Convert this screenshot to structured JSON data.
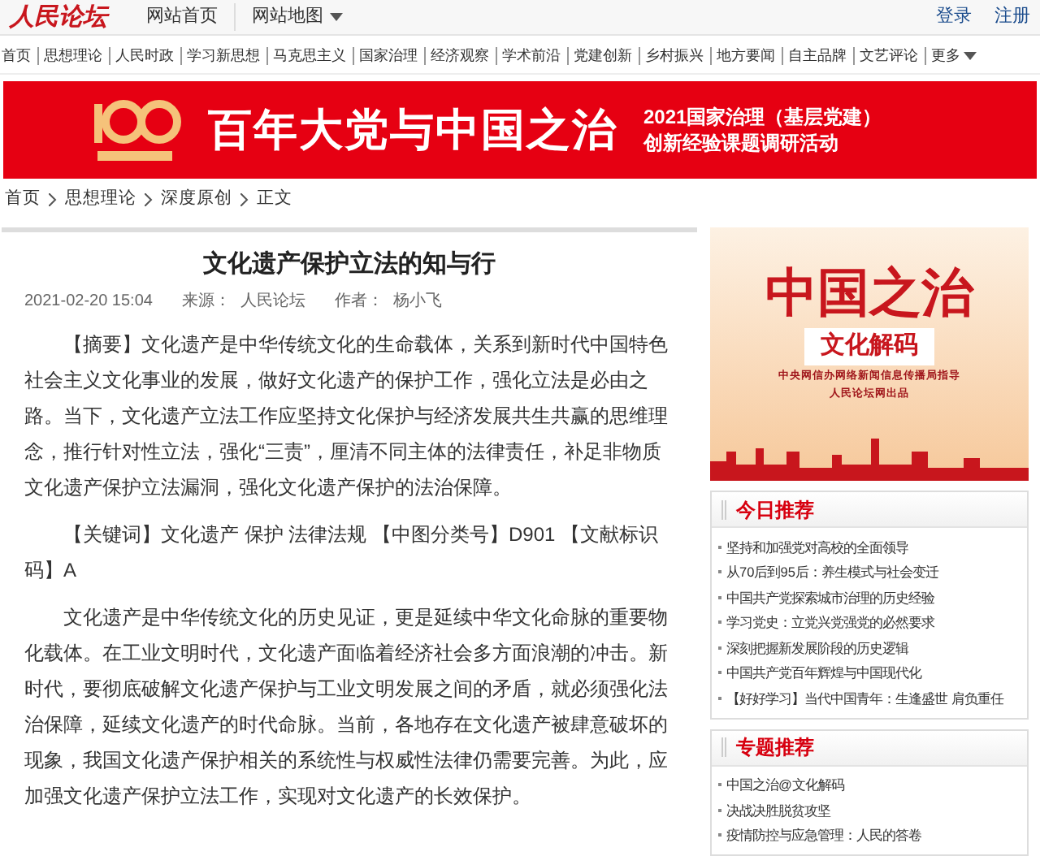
{
  "header": {
    "logo": "人民论坛",
    "links": [
      "网站首页",
      "网站地图"
    ],
    "login": "登录",
    "register": "注册"
  },
  "nav": [
    "首页",
    "思想理论",
    "人民时政",
    "学习新思想",
    "马克思主义",
    "国家治理",
    "经济观察",
    "学术前沿",
    "党建创新",
    "乡村振兴",
    "地方要闻",
    "自主品牌",
    "文艺评论"
  ],
  "nav_more": "更多",
  "banner": {
    "title": "百年大党与中国之治",
    "subtitle_lines": [
      "2021国家治理（基层党建）",
      "创新经验课题调研活动"
    ]
  },
  "breadcrumb": [
    "首页",
    "思想理论",
    "深度原创",
    "正文"
  ],
  "article": {
    "title": "文化遗产保护立法的知与行",
    "date": "2021-02-20 15:04",
    "source_label": "来源：",
    "source": "人民论坛",
    "author_label": "作者：",
    "author": "杨小飞",
    "paragraphs": [
      "【摘要】文化遗产是中华传统文化的生命载体，关系到新时代中国特色社会主义文化事业的发展，做好文化遗产的保护工作，强化立法是必由之路。当下，文化遗产立法工作应坚持文化保护与经济发展共生共赢的思维理念，推行针对性立法，强化“三责”，厘清不同主体的法律责任，补足非物质文化遗产保护立法漏洞，强化文化遗产保护的法治保障。",
      "【关键词】文化遗产 保护 法律法规 【中图分类号】D901 【文献标识码】A",
      "文化遗产是中华传统文化的历史见证，更是延续中华文化命脉的重要物化载体。在工业文明时代，文化遗产面临着经济社会多方面浪潮的冲击。新时代，要彻底破解文化遗产保护与工业文明发展之间的矛盾，就必须强化法治保障，延续文化遗产的时代命脉。当前，各地存在文化遗产被肆意破坏的现象，我国文化遗产保护相关的系统性与权威性法律仍需要完善。为此，应加强文化遗产保护立法工作，实现对文化遗产的长效保护。"
    ]
  },
  "promo": {
    "title": "中国之治",
    "tag": "文化解码",
    "lines": [
      "中央网信办网络新闻信息传播局指导",
      "人民论坛网出品"
    ]
  },
  "sidebar_boxes": [
    {
      "title": "今日推荐",
      "items": [
        "坚持和加强党对高校的全面领导",
        "从70后到95后：养生模式与社会变迁",
        "中国共产党探索城市治理的历史经验",
        "学习党史：立党兴党强党的必然要求",
        "深刻把握新发展阶段的历史逻辑",
        "中国共产党百年辉煌与中国现代化",
        "【好好学习】当代中国青年：生逢盛世 肩负重任"
      ]
    },
    {
      "title": "专题推荐",
      "items": [
        "中国之治@文化解码",
        "决战决胜脱贫攻坚",
        "疫情防控与应急管理：人民的答卷"
      ]
    }
  ]
}
